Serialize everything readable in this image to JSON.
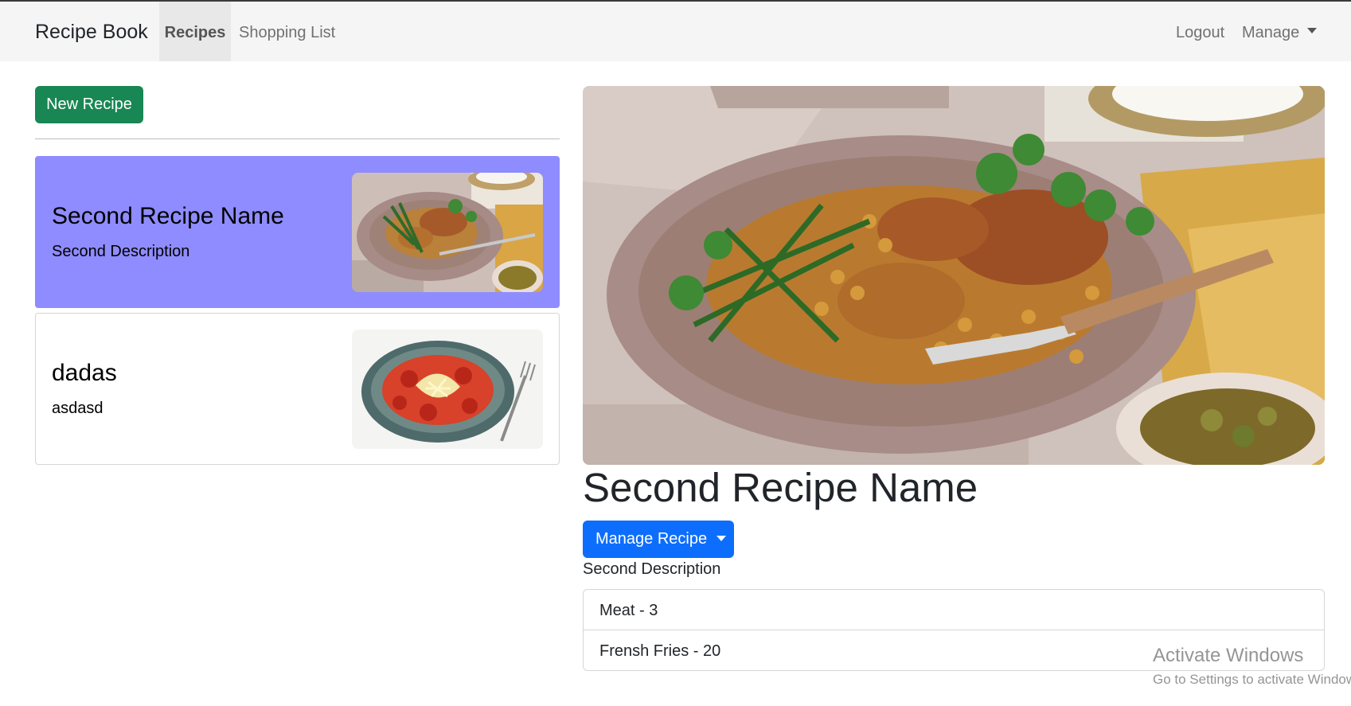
{
  "navbar": {
    "brand": "Recipe Book",
    "links": [
      {
        "label": "Recipes",
        "active": true
      },
      {
        "label": "Shopping List",
        "active": false
      }
    ],
    "right": {
      "logout": "Logout",
      "manage": "Manage"
    }
  },
  "sidebar": {
    "new_recipe_label": "New Recipe",
    "recipes": [
      {
        "name": "Second Recipe Name",
        "description": "Second Description",
        "image": "curry-dish-photo",
        "active": true
      },
      {
        "name": "dadas",
        "description": "asdasd",
        "image": "spaghetti-plate-photo",
        "active": false
      }
    ]
  },
  "detail": {
    "image": "curry-dish-photo",
    "name": "Second Recipe Name",
    "manage_label": "Manage Recipe",
    "description": "Second Description",
    "ingredients": [
      {
        "text": "Meat - 3"
      },
      {
        "text": "Frensh Fries - 20"
      }
    ]
  },
  "watermark": {
    "title": "Activate Windows",
    "subtitle": "Go to Settings to activate Windows."
  },
  "colors": {
    "active_card": "#8f8cff",
    "new_button": "#198754",
    "manage_button": "#0d6efd",
    "navbar_bg": "#f5f5f5"
  }
}
